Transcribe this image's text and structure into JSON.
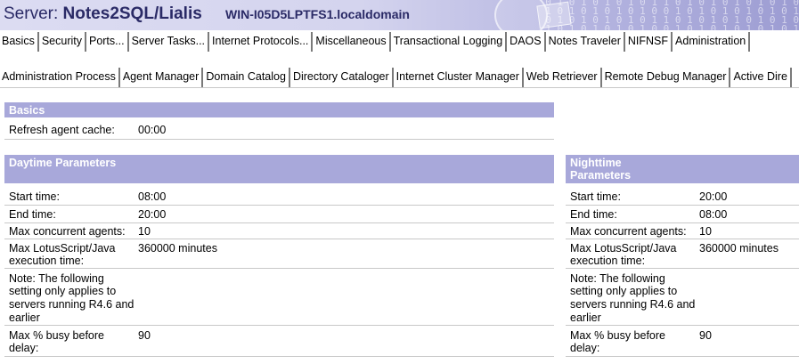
{
  "header": {
    "server_prefix": "Server: ",
    "server_name": "Notes2SQL/Lialis",
    "domain": "WIN-I05D5LPTFS1.localdomain",
    "binary_art": "0 1 0 1 0 1 0 1 0 1 1 0 1 0 1 0 1 0 1 0 1 0\n1 0 1 0 1 0 1 0 1 0 0 1 0 1 0 1 0 1 0 1 0 1\n0 1 0 1 0 1 0 1 0 1 1 0 1 0 1 0 1 0 1 0 1 0\n1 0 1 0 1 0 1 0 1 0 0 1 0 1 0 1 0 1 0 1 0 1"
  },
  "primary_tabs": [
    "Basics",
    "Security",
    "Ports...",
    "Server Tasks...",
    "Internet Protocols...",
    "Miscellaneous",
    "Transactional Logging",
    "DAOS",
    "Notes Traveler",
    "NIFNSF",
    "Administration"
  ],
  "secondary_tabs": [
    "Administration Process",
    "Agent Manager",
    "Domain Catalog",
    "Directory Cataloger",
    "Internet Cluster Manager",
    "Web Retriever",
    "Remote Debug Manager",
    "Active Dire"
  ],
  "basics": {
    "title": "Basics",
    "refresh_label": "Refresh agent cache:",
    "refresh_value": "00:00"
  },
  "daytime": {
    "title": "Daytime Parameters",
    "start_label": "Start time:",
    "start_value": "08:00",
    "end_label": "End time:",
    "end_value": "20:00",
    "max_agents_label": "Max concurrent agents:",
    "max_agents_value": "10",
    "exec_label_1": "Max LotusScript/Java",
    "exec_label_2": "execution time:",
    "exec_value": "360000 minutes",
    "note_1": "Note: The following",
    "note_2": "setting only applies to",
    "note_3": "servers running R4.6 and",
    "note_4": "earlier",
    "busy_label_1": "Max % busy before",
    "busy_label_2": "delay:",
    "busy_value": "90"
  },
  "nighttime": {
    "title_1": "Nighttime",
    "title_2": "Parameters",
    "start_label": "Start time:",
    "start_value": "20:00",
    "end_label": "End time:",
    "end_value": "08:00",
    "max_agents_label": "Max concurrent agents:",
    "max_agents_value": "10",
    "exec_label_1": "Max LotusScript/Java",
    "exec_label_2": "execution time:",
    "exec_value": "360000 minutes",
    "note_1": "Note: The following",
    "note_2": "setting only applies to",
    "note_3": "servers running R4.6 and",
    "note_4": "earlier",
    "busy_label_1": "Max % busy before",
    "busy_label_2": "delay:",
    "busy_value": "90"
  },
  "colors": {
    "section_header": "#a8a8da",
    "banner_text": "#2a2a66"
  }
}
